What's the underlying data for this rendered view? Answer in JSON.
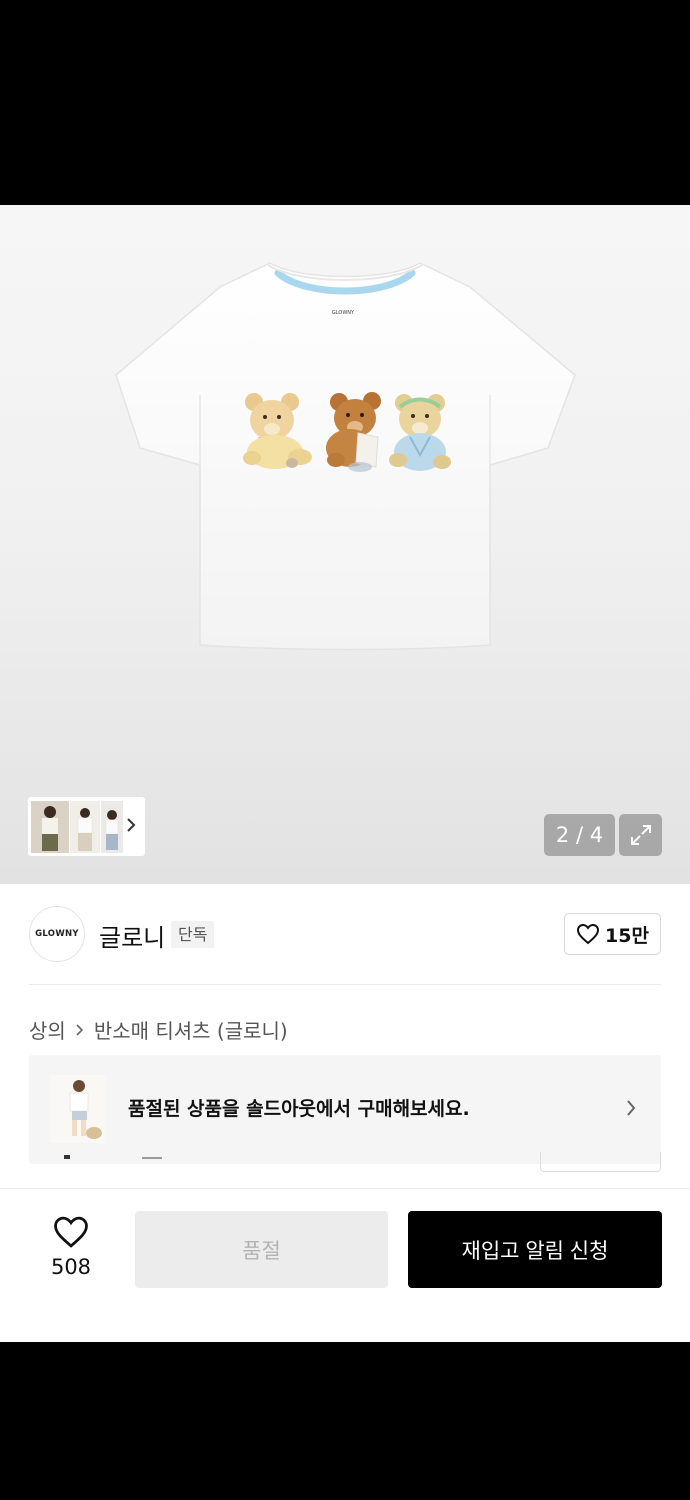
{
  "gallery": {
    "print_label": "GLOWNY",
    "counter": "2 / 4",
    "current_index": 2,
    "total_images": 4
  },
  "brand": {
    "logo_text": "GLOWNY",
    "name": "글로니",
    "badge": "단독",
    "likes": "15만"
  },
  "breadcrumb": [
    "상의",
    "반소매 티셔츠 (글로니)"
  ],
  "soldout_banner": {
    "text": "품절된 상품을 솔드아웃에서 구매해보세요."
  },
  "action_bar": {
    "wish_count": "508",
    "soldout_label": "품절",
    "restock_label": "재입고 알림 신청"
  },
  "colors": {
    "primary_button": "#000000",
    "disabled_button": "#ececec",
    "neckline_trim": "#a9d8ee"
  },
  "icons": [
    "heart-icon",
    "chevron-right-icon",
    "expand-icon"
  ]
}
